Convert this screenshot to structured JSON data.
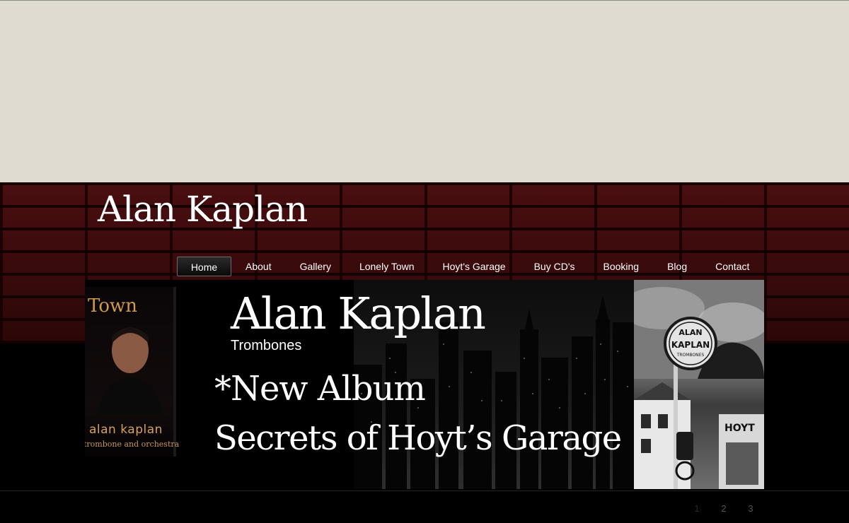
{
  "site": {
    "title": "Alan Kaplan"
  },
  "nav": {
    "items": [
      {
        "label": "Home",
        "active": true
      },
      {
        "label": "About"
      },
      {
        "label": "Gallery"
      },
      {
        "label": "Lonely Town"
      },
      {
        "label": "Hoyt's Garage"
      },
      {
        "label": "Buy CD's"
      },
      {
        "label": "Booking"
      },
      {
        "label": "Blog"
      },
      {
        "label": "Contact"
      }
    ]
  },
  "banner": {
    "name": "Alan Kaplan",
    "subtitle": "Trombones",
    "line1": "*New Album",
    "line2": "Secrets of Hoyt’s Garage",
    "album_cover": {
      "title_word": "Town",
      "artist": "alan kaplan",
      "subtitle": "trombone and orchestra"
    },
    "sign": {
      "line1": "ALAN",
      "line2": "KAPLAN",
      "line3": "TROMBONES",
      "building_text": "HOYT"
    }
  },
  "pager": {
    "pages": [
      "1",
      "2",
      "3"
    ],
    "current": "1"
  },
  "colors": {
    "top_band": "#dfdbd0",
    "brick": "#3a0a0b",
    "background": "#000000",
    "album_accent": "#d09a48",
    "text": "#ffffff"
  }
}
